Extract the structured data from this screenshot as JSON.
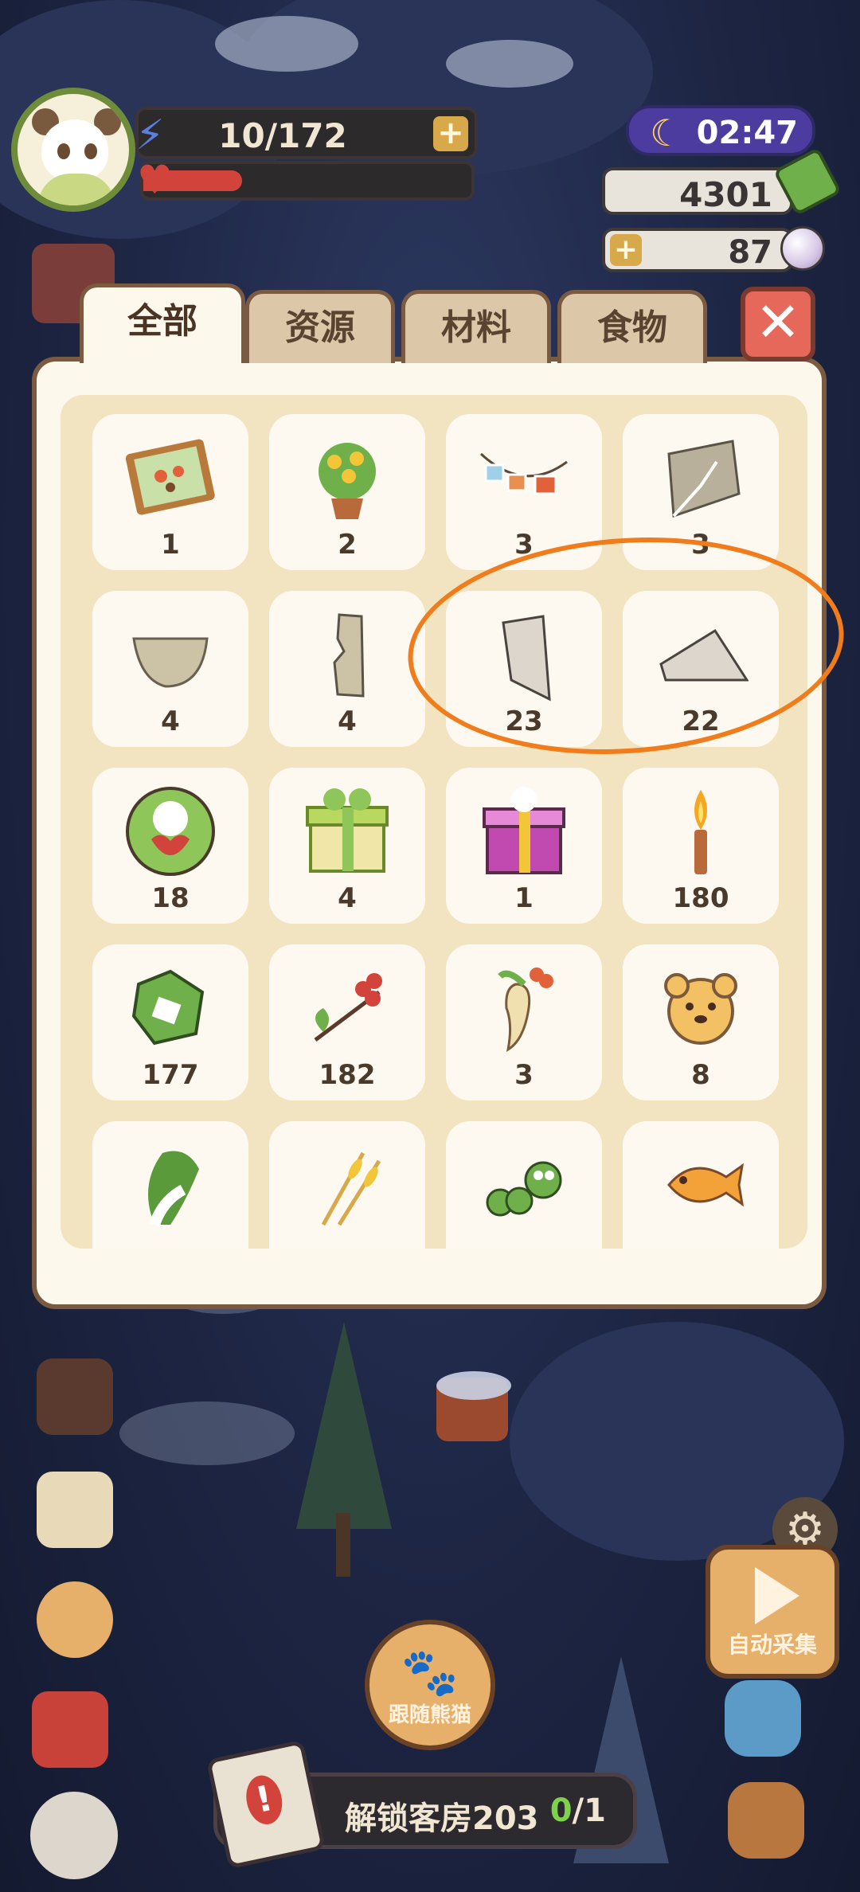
{
  "hud": {
    "energy": "10/172",
    "energy_plus": "+",
    "health_fraction": 0.3,
    "time": "02:47",
    "gold": "4301",
    "pearls": "87",
    "pearls_plus": "+"
  },
  "tabs": [
    {
      "label": "全部",
      "active": true
    },
    {
      "label": "资源",
      "active": false
    },
    {
      "label": "材料",
      "active": false
    },
    {
      "label": "食物",
      "active": false
    }
  ],
  "close_label": "✕",
  "items": [
    {
      "icon": "butterfly-frame-icon",
      "qty": "1"
    },
    {
      "icon": "flower-pot-icon",
      "qty": "2"
    },
    {
      "icon": "photo-garland-icon",
      "qty": "3"
    },
    {
      "icon": "map-fragment-icon",
      "qty": "3"
    },
    {
      "icon": "map-fragment-half-icon",
      "qty": "4"
    },
    {
      "icon": "map-fragment-strip-icon",
      "qty": "4"
    },
    {
      "icon": "map-fragment-shard-icon",
      "qty": "23"
    },
    {
      "icon": "map-fragment-triangle-icon",
      "qty": "22"
    },
    {
      "icon": "panda-heart-badge-icon",
      "qty": "18"
    },
    {
      "icon": "green-gift-box-icon",
      "qty": "4"
    },
    {
      "icon": "pink-gift-box-icon",
      "qty": "1"
    },
    {
      "icon": "candle-icon",
      "qty": "180"
    },
    {
      "icon": "leafy-scrap-icon",
      "qty": "177"
    },
    {
      "icon": "berry-branch-icon",
      "qty": "182"
    },
    {
      "icon": "ginseng-root-icon",
      "qty": "3"
    },
    {
      "icon": "bear-cookie-icon",
      "qty": "8"
    },
    {
      "icon": "bok-choy-icon",
      "qty": ""
    },
    {
      "icon": "wheat-icon",
      "qty": ""
    },
    {
      "icon": "caterpillar-icon",
      "qty": ""
    },
    {
      "icon": "fish-icon",
      "qty": ""
    }
  ],
  "bottom": {
    "follow_label": "跟随熊猫",
    "auto_label": "自动采集",
    "task_label": "解锁客房203",
    "task_done": "0",
    "task_total": "/1"
  },
  "colors": {
    "highlight": "#f07c1c",
    "panel": "#fdf8ec",
    "panel_inner": "#f2e4c0",
    "close": "#e5685a"
  }
}
